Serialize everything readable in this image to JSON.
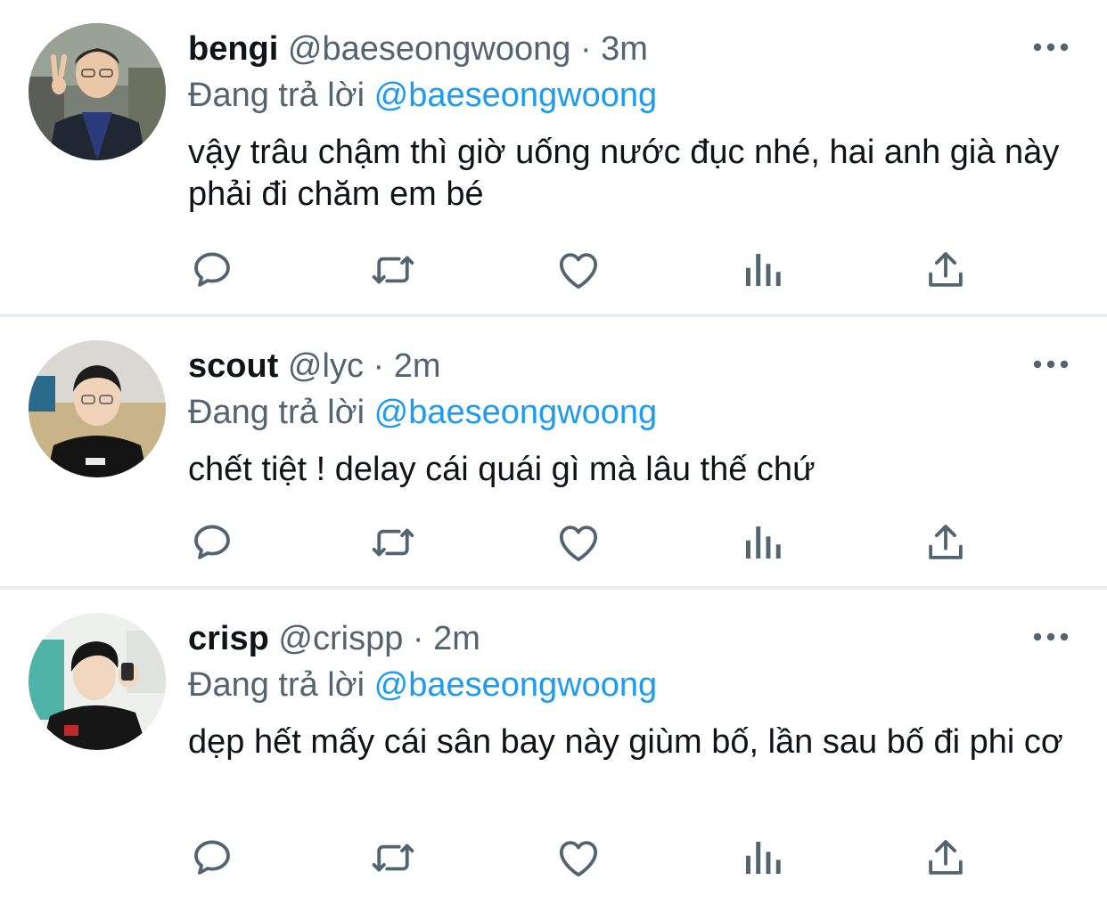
{
  "reply_prefix": "Đang trả lời",
  "separator": "·",
  "tweets": [
    {
      "name": "bengi",
      "handle": "@baeseongwoong",
      "time": "3m",
      "reply_to": "@baeseongwoong",
      "text": "vậy trâu chậm thì giờ uống nước đục nhé, hai anh già này phải đi chăm em bé"
    },
    {
      "name": "scout",
      "handle": "@lyc",
      "time": "2m",
      "reply_to": "@baeseongwoong",
      "text": "chết tiệt ! delay cái quái gì mà lâu thế chứ"
    },
    {
      "name": "crisp",
      "handle": "@crispp",
      "time": "2m",
      "reply_to": "@baeseongwoong",
      "text": "dẹp hết mấy cái sân bay này giùm bố, lần sau bố đi phi cơ"
    }
  ],
  "icons": {
    "reply": "reply-icon",
    "retweet": "retweet-icon",
    "like": "like-icon",
    "views": "views-icon",
    "share": "share-icon",
    "more": "more-icon"
  },
  "colors": {
    "text_primary": "#0f1419",
    "text_secondary": "#536471",
    "link": "#1d9bf0",
    "divider": "#e6ecf0"
  }
}
